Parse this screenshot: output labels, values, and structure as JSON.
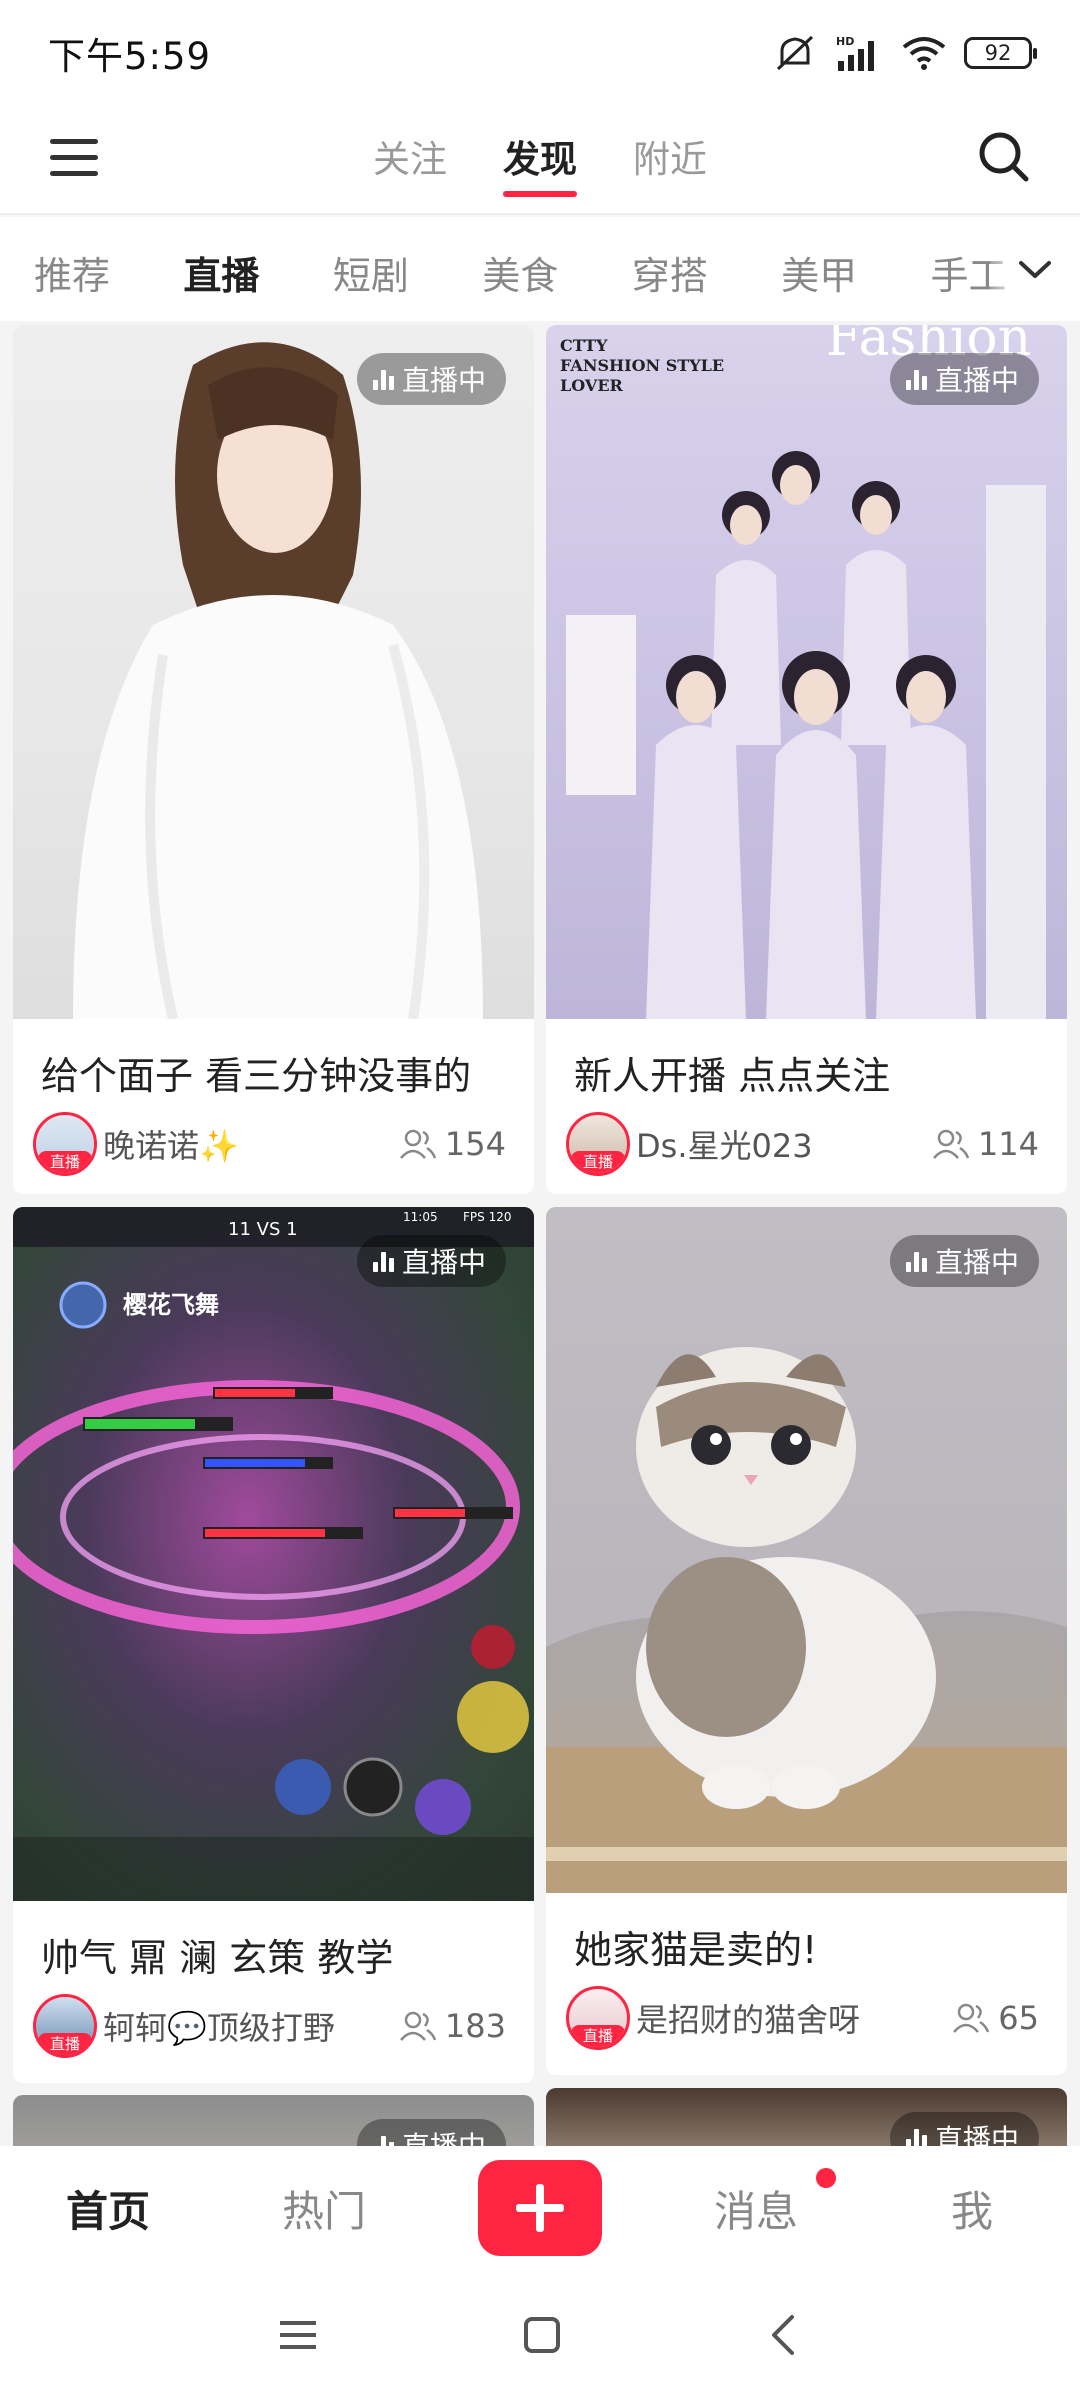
{
  "status_bar": {
    "time": "下午5:59",
    "battery": "92",
    "network": "HD"
  },
  "top_nav": {
    "tabs": [
      {
        "label": "关注"
      },
      {
        "label": "发现"
      },
      {
        "label": "附近"
      }
    ]
  },
  "categories": [
    "推荐",
    "直播",
    "短剧",
    "美食",
    "穿搭",
    "美甲",
    "手工"
  ],
  "live_badge": "直播中",
  "avatar_live_tag": "直播",
  "cards": [
    {
      "title": "给个面子 看三分钟没事的",
      "author": "晚诺诺✨",
      "viewers": "154"
    },
    {
      "title": "新人开播 点点关注",
      "author": "Ds.星光023",
      "viewers": "114"
    },
    {
      "title": "帅气 鼏 澜 玄策 教学",
      "author": "轲轲💬顶级打野",
      "viewers": "183"
    },
    {
      "title": "她家猫是卖的!",
      "author": "是招财的猫舍呀",
      "viewers": "65"
    }
  ],
  "poster_text": {
    "line1": "CTTY",
    "line2": "FANSHION STYLE",
    "line3": "LOVER",
    "script": "Fashion"
  },
  "game_overlay": {
    "player_name": "樱花飞舞",
    "score": "11 VS 1",
    "fps": "FPS 120",
    "time": "11:05"
  },
  "bottom_nav": {
    "home": "首页",
    "hot": "热门",
    "messages": "消息",
    "me": "我"
  },
  "colors": {
    "accent": "#ff2442"
  }
}
